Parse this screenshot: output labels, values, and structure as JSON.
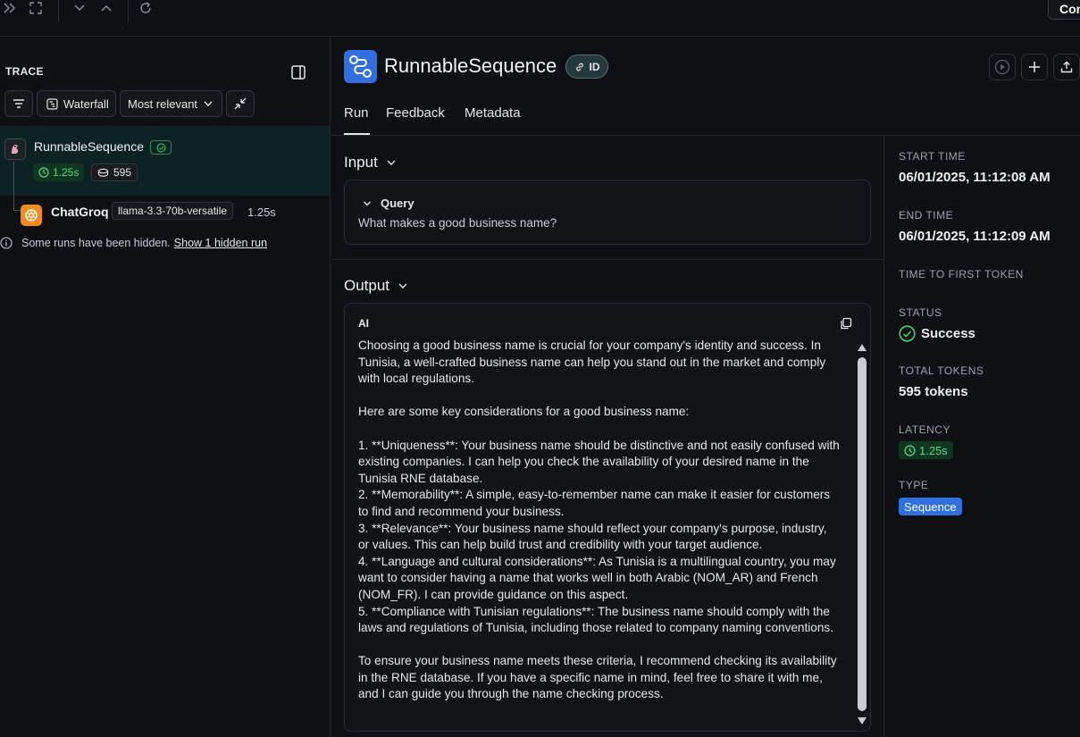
{
  "topbar": {
    "icons": [
      "double-chevron-right-icon",
      "expand-icon",
      "chevron-down-icon",
      "chevron-up-icon",
      "refresh-icon"
    ],
    "right_button_label": "Con"
  },
  "trace": {
    "label": "TRACE",
    "toolbar": {
      "waterfall_label": "Waterfall",
      "relevance_label": "Most relevant"
    },
    "root": {
      "name": "RunnableSequence",
      "latency": "1.25s",
      "tokens": "595"
    },
    "child": {
      "name": "ChatGroq",
      "model": "llama-3.3-70b-versatile",
      "latency": "1.25s"
    },
    "hidden_notice": "Some runs have been hidden.",
    "hidden_link": "Show 1 hidden run"
  },
  "header": {
    "title": "RunnableSequence",
    "id_badge": "ID"
  },
  "tabs": {
    "run": "Run",
    "feedback": "Feedback",
    "metadata": "Metadata"
  },
  "input": {
    "title": "Input",
    "query_label": "Query",
    "query_value": "What makes a good business name?"
  },
  "output": {
    "title": "Output",
    "role": "AI",
    "text": "Choosing a good business name is crucial for your company's identity and success. In Tunisia, a well-crafted business name can help you stand out in the market and comply with local regulations.\n\nHere are some key considerations for a good business name:\n\n1. **Uniqueness**: Your business name should be distinctive and not easily confused with existing companies. I can help you check the availability of your desired name in the Tunisia RNE database.\n2. **Memorability**: A simple, easy-to-remember name can make it easier for customers to find and recommend your business.\n3. **Relevance**: Your business name should reflect your company's purpose, industry, or values. This can help build trust and credibility with your target audience.\n4. **Language and cultural considerations**: As Tunisia is a multilingual country, you may want to consider having a name that works well in both Arabic (NOM_AR) and French (NOM_FR). I can provide guidance on this aspect.\n5. **Compliance with Tunisian regulations**: The business name should comply with the laws and regulations of Tunisia, including those related to company naming conventions.\n\nTo ensure your business name meets these criteria, I recommend checking its availability in the RNE database. If you have a specific name in mind, feel free to share it with me, and I can guide you through the name checking process."
  },
  "meta": {
    "start_time_label": "START TIME",
    "start_time": "06/01/2025, 11:12:08 AM",
    "end_time_label": "END TIME",
    "end_time": "06/01/2025, 11:12:09 AM",
    "ttft_label": "TIME TO FIRST TOKEN",
    "status_label": "STATUS",
    "status": "Success",
    "tokens_label": "TOTAL TOKENS",
    "tokens": "595 tokens",
    "latency_label": "LATENCY",
    "latency": "1.25s",
    "type_label": "TYPE",
    "type": "Sequence"
  },
  "colors": {
    "accent_blue": "#2f6fdf",
    "success_green": "#3bd671",
    "orange": "#f38a1a"
  }
}
